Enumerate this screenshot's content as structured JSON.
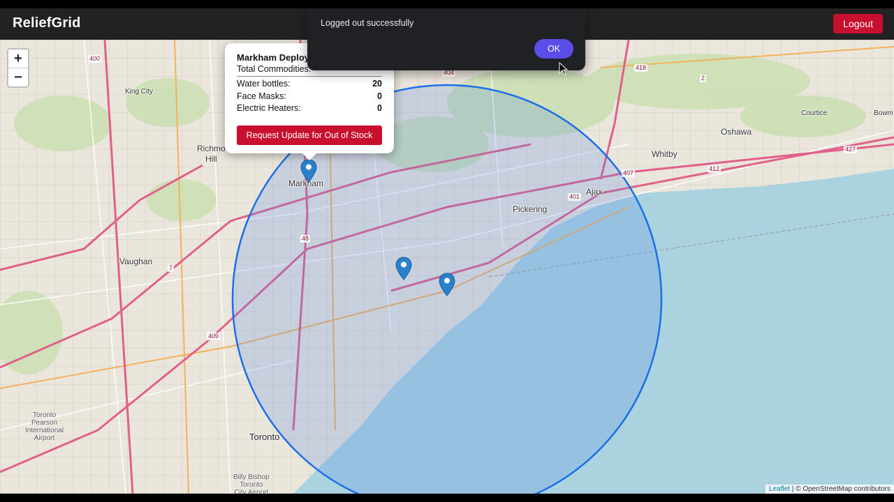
{
  "header": {
    "brand": "ReliefGrid",
    "logout_label": "Logout"
  },
  "dialog": {
    "message": "Logged out successfully",
    "ok_label": "OK"
  },
  "zoom": {
    "in": "+",
    "out": "−"
  },
  "popup": {
    "title": "Markham Deploy",
    "subtitle": "Total Commodities:",
    "commodities": [
      {
        "name": "Water bottles:",
        "qty": "20"
      },
      {
        "name": "Face Masks:",
        "qty": "0"
      },
      {
        "name": "Electric Heaters:",
        "qty": "0"
      }
    ],
    "request_label": "Request Update for Out of Stock"
  },
  "map": {
    "places": {
      "markham": "Markham",
      "pickering": "Pickering",
      "ajax": "Ajax",
      "oshawa": "Oshawa",
      "whitby": "Whitby",
      "courtice": "Courtice",
      "bowm": "Bowm",
      "vaughan": "Vaughan",
      "king_city": "King City",
      "richmond_hill": "Richmo\nHill",
      "toronto": "Toronto",
      "pearson": "Toronto\nPearson\nInternational\nAirport",
      "billy_bishop": "Billy Bishop\nToronto\nCity Airport"
    },
    "routes": [
      "400",
      "401",
      "404",
      "407",
      "412",
      "418",
      "427",
      "409",
      "2",
      "7",
      "48"
    ],
    "markers": [
      "markham-marker",
      "scarborough-marker",
      "east-marker"
    ]
  },
  "attribution": {
    "leaflet": "Leaflet",
    "rest": " | © OpenStreetMap contributors"
  },
  "colors": {
    "header": "#222222",
    "danger": "#c8102e",
    "ok": "#5b4ee8",
    "radius": "#1a6fe8",
    "water": "#aad3df"
  }
}
